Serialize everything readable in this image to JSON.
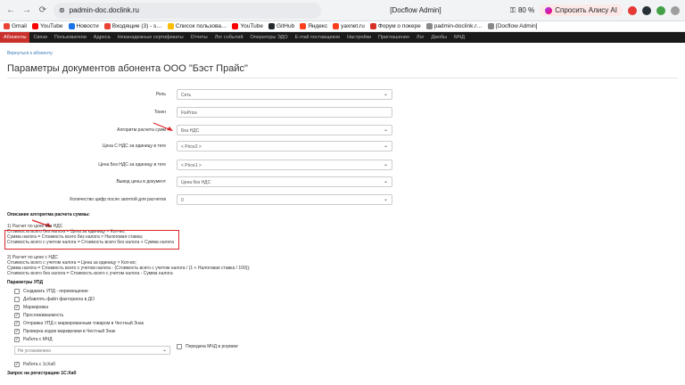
{
  "browser": {
    "url": "padmin-doc.doclink.ru",
    "title": "[Docflow Admin]",
    "zoom": "80 %",
    "alice_label": "Спросить Алису AI"
  },
  "bookmarks": [
    {
      "label": "Gmail",
      "color": "#ea4335"
    },
    {
      "label": "YouTube",
      "color": "#ff0000"
    },
    {
      "label": "Новости",
      "color": "#1a73e8"
    },
    {
      "label": "Входящие (3) - s…",
      "color": "#ea4335"
    },
    {
      "label": "Список пользова…",
      "color": "#fbbc04"
    },
    {
      "label": "YouTube",
      "color": "#ff0000"
    },
    {
      "label": "GitHub",
      "color": "#24292e"
    },
    {
      "label": "Яндекс",
      "color": "#fc3f1d"
    },
    {
      "label": "yaxnet.ru",
      "color": "#fc3f1d"
    },
    {
      "label": "Форум о покере",
      "color": "#d93025"
    },
    {
      "label": "padmin-doclink.r…",
      "color": "#888888"
    },
    {
      "label": "[Docflow Admin]",
      "color": "#888888"
    }
  ],
  "menu": [
    "Абоненты",
    "Связи",
    "Пользователи",
    "Адреса",
    "Неканадежные сертификаты",
    "Отчеты",
    "Лог событий",
    "Операторы ЭДО",
    "E-mail поставщиков",
    "Настройки",
    "Приглашения",
    "Лог",
    "Джобы",
    "МЧД"
  ],
  "page": {
    "back_link": "Вернуться к абоненту",
    "heading": "Параметры документов абонента ООО \"Бэст Прайс\""
  },
  "form": [
    {
      "label": "Роль",
      "value": "Сеть",
      "type": "select"
    },
    {
      "label": "Токен",
      "value": "FixPrice",
      "type": "input"
    },
    {
      "label": "Алгоритм расчета сумм",
      "value": "Без НДС",
      "type": "select"
    },
    {
      "label": "Цена С НДС за единицу в теге",
      "value": "< Price2 >",
      "type": "select"
    },
    {
      "label": "Цена Без НДС за единицу в теге",
      "value": "< Price1 >",
      "type": "select"
    },
    {
      "label": "Вывод цены в документ",
      "value": "Цена без НДС",
      "type": "select"
    },
    {
      "label": "Количество цифр после запятой для расчетов",
      "value": "0",
      "type": "select"
    }
  ],
  "algorithm": {
    "title": "Описание алгоритма расчета суммы:",
    "block1": [
      "1) Расчет по цене без НДС",
      "Стоимость всего без налога = Цена за единицу × Кол-во;",
      "Сумма налога = Стоимость всего без налога × Налоговая ставка;",
      "Стоимость всего с учетом налога = Стоимость всего без налога + Сумма налога"
    ],
    "block2": [
      "2) Расчет по цене с НДС",
      "Стоимость всего с учетом налога = Цена за единицу × Кол-во;",
      "Сумма налога = Стоимость всего с учетом налога - (Стоимость всего с учетом налога / (1 + Налоговая ставка / 100));",
      "Стоимость всего без налога = Стоимость всего с учетом налога - Сумма налога"
    ]
  },
  "upd": {
    "title": "Параметры УПД",
    "options": [
      {
        "label": "Создавать УПД - перемещение",
        "checked": false
      },
      {
        "label": "Добавлять файл факторинга в ДО",
        "checked": false
      },
      {
        "label": "Маркировка",
        "checked": true
      },
      {
        "label": "Прослеживаемость",
        "checked": true
      },
      {
        "label": "Отправка УПД с маркированным товаром в Честный Знак",
        "checked": true
      },
      {
        "label": "Проверка кодов маркировки в Честный Знак",
        "checked": true
      },
      {
        "label": "Работа с МЧД",
        "checked": true
      }
    ],
    "mchd_select": "Не установлено",
    "mchd_roaming": "Передача МЧД в роуминг",
    "hub": {
      "label": "Работа с 1cХаб",
      "checked": true
    },
    "registration_title": "Запрос на регистрацию 1С:Хаб"
  }
}
